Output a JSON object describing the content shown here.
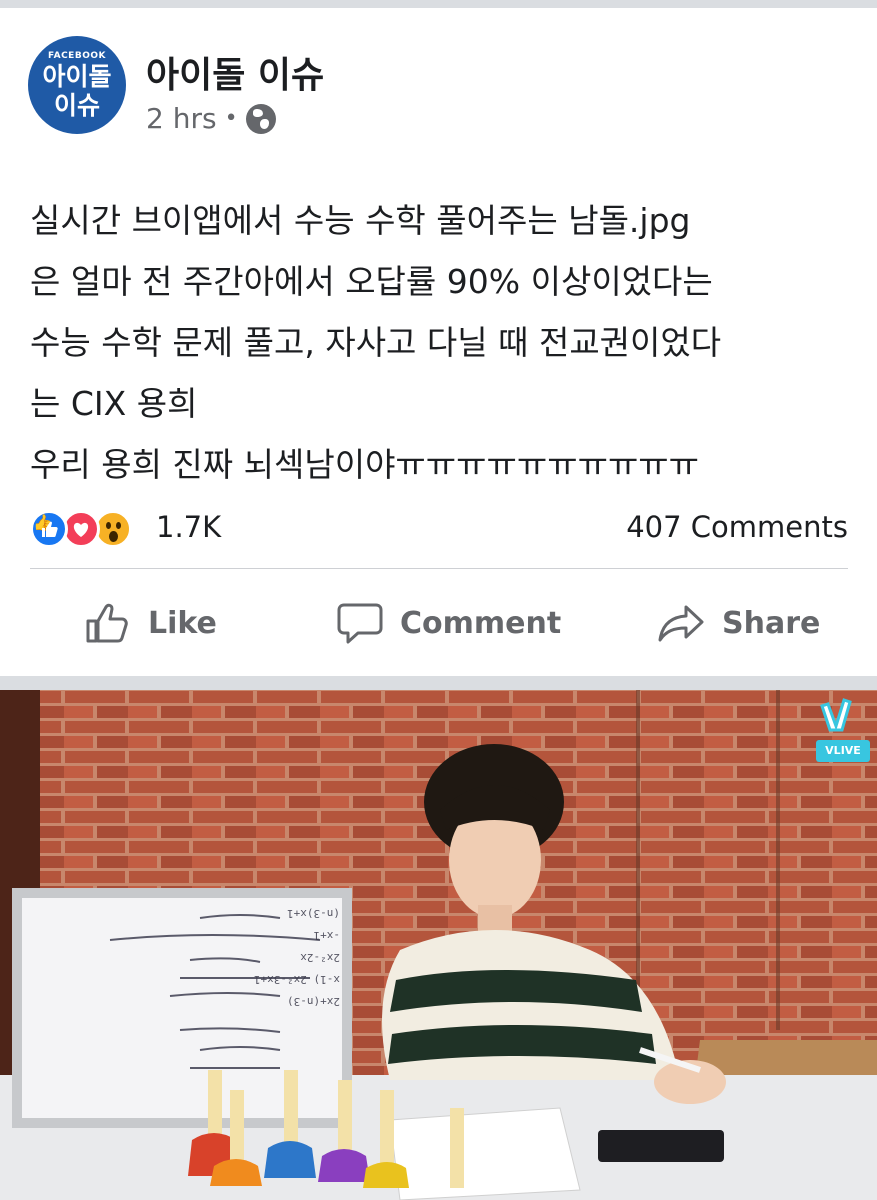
{
  "post": {
    "avatar": {
      "line_top": "FACEBOOK",
      "line1": "아이돌",
      "line2": "이슈"
    },
    "page_name": "아이돌 이슈",
    "time": "2 hrs",
    "separator_dot": "•",
    "text_lines": [
      "실시간 브이앱에서 수능 수학 풀어주는 남돌.jpg",
      "은 얼마 전 주간아에서 오답률 90% 이상이었다는",
      "수능 수학 문제 풀고, 자사고 다닐 때 전교권이었다",
      "는 CIX 용희",
      "우리 용희 진짜 뇌섹남이야ㅠㅠㅠㅠㅠㅠㅠㅠㅠㅠ"
    ]
  },
  "reactions": {
    "icons": [
      "like-icon",
      "love-icon",
      "wow-icon"
    ],
    "count": "1.7K",
    "comments": "407 Comments"
  },
  "actions": {
    "like_label": "Like",
    "comment_label": "Comment",
    "share_label": "Share"
  },
  "media": {
    "badge_text": "VLIVE",
    "whiteboard_lines": [
      "2x+(n-3)",
      "x-1) 2x²-3x+1",
      "2x²-2x",
      "-x+1",
      "(n-3)x+1"
    ]
  },
  "colors": {
    "brand_blue": "#1f5aa6",
    "like_blue": "#1877f2",
    "love_red": "#f33e58",
    "wow_yellow": "#f7b125",
    "muted_text": "#65676b",
    "vlive_teal": "#38c6e0"
  }
}
